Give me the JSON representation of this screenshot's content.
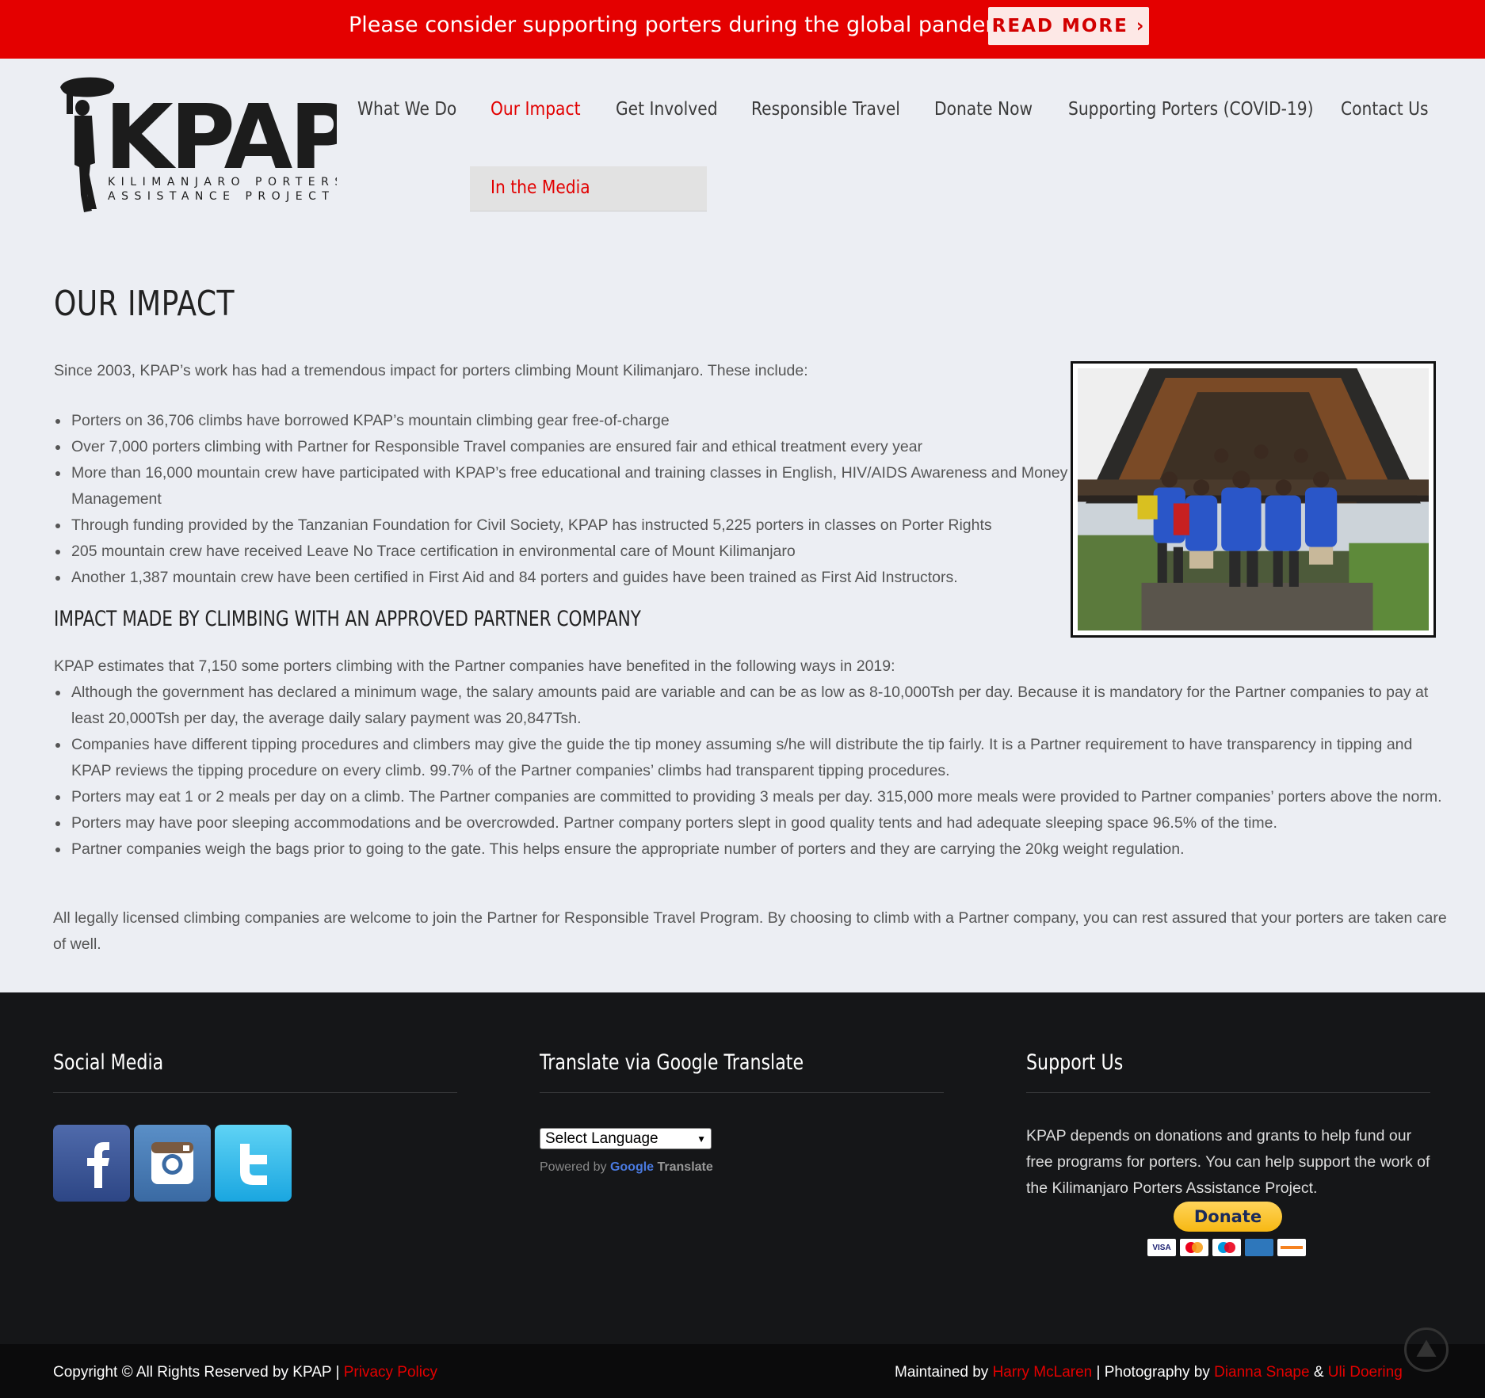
{
  "banner": {
    "text": "Please consider supporting porters during the global pandemic.",
    "button": "READ MORE ›"
  },
  "logo": {
    "wordmark": "KPAP",
    "tagline_1": "KILIMANJARO PORTERS",
    "tagline_2": "ASSISTANCE PROJECT"
  },
  "nav": {
    "items": [
      {
        "label": "What We Do"
      },
      {
        "label": "Our Impact"
      },
      {
        "label": "Get Involved"
      },
      {
        "label": "Responsible Travel"
      },
      {
        "label": "Donate Now"
      },
      {
        "label": "Supporting Porters (COVID-19)"
      },
      {
        "label": "Contact Us"
      }
    ],
    "active": "Our Impact",
    "submenu": {
      "label": "In the Media"
    }
  },
  "content": {
    "title": "OUR IMPACT",
    "intro": "Since 2003, KPAP’s work has had a tremendous impact for porters climbing Mount Kilimanjaro. These include:",
    "impacts": [
      "Porters on 36,706 climbs have borrowed KPAP’s mountain climbing gear free-of-charge",
      "Over 7,000 porters climbing with Partner for Responsible Travel companies are ensured fair and ethical treatment every year",
      "More than 16,000 mountain crew have participated with KPAP’s free educational and training classes in English, HIV/AIDS Awareness and Money Management",
      "Through funding provided by the Tanzanian Foundation for Civil Society, KPAP has instructed 5,225 porters in classes on Porter Rights",
      "205 mountain crew have received Leave No Trace certification in environmental care of Mount Kilimanjaro",
      "Another 1,387 mountain crew have been certified in First Aid and 84 porters and guides have been trained as First Aid Instructors."
    ],
    "subheading": "IMPACT MADE BY CLIMBING WITH AN APPROVED PARTNER COMPANY",
    "intro2": "KPAP estimates that 7,150 some porters climbing with the Partner companies have benefited in the following ways in 2019:",
    "benefits": [
      "Although the government has declared a minimum wage, the salary amounts paid are variable and can be as low as 8-10,000Tsh per day.  Because it is mandatory for the Partner companies to pay at least 20,000Tsh per day, the average daily salary payment was 20,847Tsh.",
      "Companies have different tipping procedures and climbers may give the guide the tip money assuming s/he will distribute the tip fairly.  It is a Partner requirement to have transparency in tipping and KPAP reviews the tipping procedure on every climb. 99.7% of the Partner companies’ climbs had transparent tipping procedures.",
      "Porters may eat 1 or 2 meals per day on a climb.  The Partner companies are committed to providing 3 meals per day.  315,000 more meals were provided to Partner companies’ porters above the norm.",
      "Porters may have poor sleeping accommodations and be overcrowded.  Partner company porters slept in good quality tents and had adequate sleeping space 96.5% of the time.",
      "Partner companies weigh the bags prior to going to the gate.  This helps ensure the appropriate number of porters and they are carrying the 20kg weight regulation."
    ],
    "outro": "All legally licensed climbing companies are welcome to join the Partner for Responsible Travel Program.  By choosing to climb with a Partner company, you can rest assured that your porters are taken care of well."
  },
  "footer": {
    "social": {
      "heading": "Social Media",
      "icons": [
        "facebook-icon",
        "instagram-icon",
        "twitter-icon"
      ]
    },
    "translate": {
      "heading": "Translate via Google Translate",
      "select_value": "Select Language",
      "powered_by": "Powered by",
      "google": "Google",
      "translate": "Translate"
    },
    "support": {
      "heading": "Support Us",
      "text": "KPAP depends on donations and grants to help fund our free programs for porters. You can help support the work of the Kilimanjaro Porters Assistance Project.",
      "donate": "Donate",
      "cards": [
        "VISA",
        "mastercard",
        "maestro",
        "amex",
        "discover"
      ]
    }
  },
  "bottom": {
    "copyright": "Copyright © All Rights Reserved by KPAP",
    "sep": "|",
    "privacy": "Privacy Policy",
    "maintained_label": "Maintained by",
    "maintainer": "Harry McLaren",
    "photo_label": "Photography by",
    "photographer1": "Dianna Snape",
    "amp": "&",
    "photographer2": "Uli Doering"
  },
  "colors": {
    "accent": "#e20000",
    "banner": "#e40000",
    "footer": "#151618",
    "page": "#eceef3"
  }
}
